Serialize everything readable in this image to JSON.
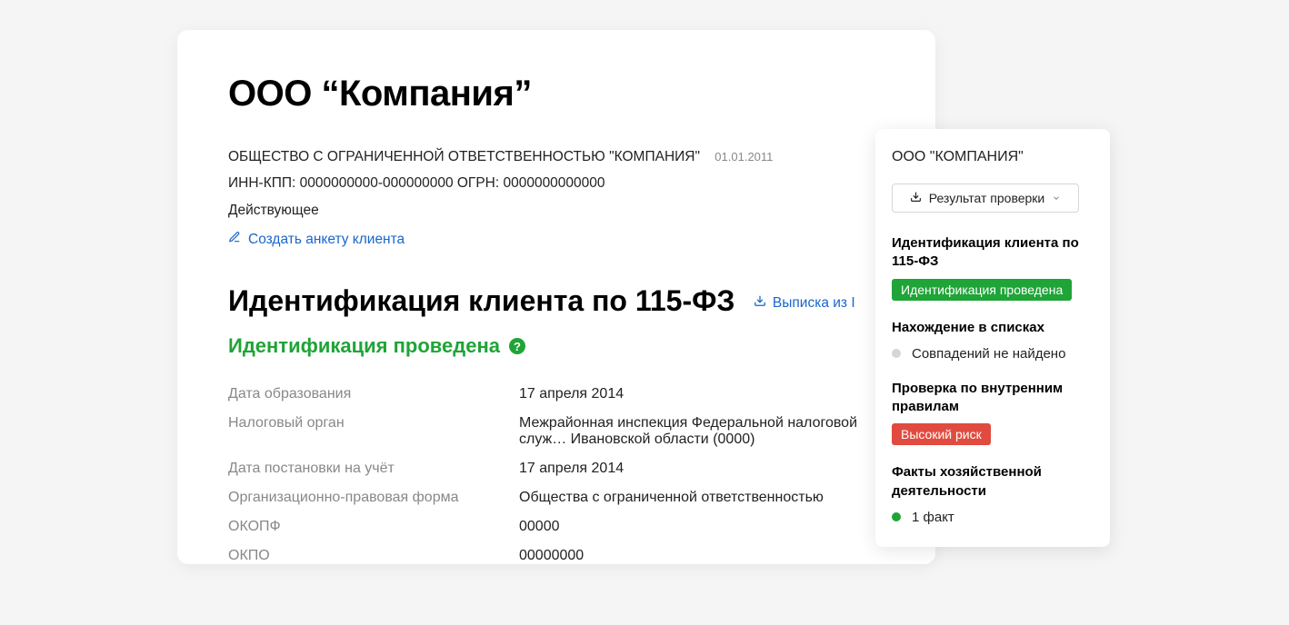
{
  "company": {
    "title": "ООО “Компания”",
    "full_name": "ОБЩЕСТВО С ОГРАНИЧЕННОЙ ОТВЕТСТВЕННОСТЬЮ \"КОМПАНИЯ\"",
    "reg_date_small": "01.01.2011",
    "inn_kpp_ogrn": "ИНН-КПП: 0000000000-000000000 ОГРН: 0000000000000",
    "status": "Действующее",
    "create_link": "Создать анкету клиента"
  },
  "identification": {
    "heading": "Идентификация клиента по 115-ФЗ",
    "download_excerpt": "Выписка из I",
    "status_text": "Идентификация проведена",
    "rows": [
      {
        "key": "Дата образования",
        "val": "17 апреля 2014"
      },
      {
        "key": "Налоговый орган",
        "val": "Межрайонная инспекция Федеральной налоговой служ… Ивановской области (0000)"
      },
      {
        "key": "Дата постановки на учёт",
        "val": "17 апреля 2014"
      },
      {
        "key": "Организационно-правовая форма",
        "val": "Общества с ограниченной ответственностью"
      },
      {
        "key": "ОКОПФ",
        "val": "00000"
      },
      {
        "key": "ОКПО",
        "val": "00000000"
      }
    ]
  },
  "sidebar": {
    "title": "ООО \"КОМПАНИЯ\"",
    "result_button": "Результат проверки",
    "sections": {
      "identification": {
        "title": "Идентификация клиента по 115-ФЗ",
        "badge": "Идентификация проведена"
      },
      "lists": {
        "title": "Нахождение в списках",
        "status": "Совпадений не найдено"
      },
      "internal": {
        "title": "Проверка по внутренним правилам",
        "badge": "Высокий риск"
      },
      "facts": {
        "title": "Факты хозяйственной деятельности",
        "status": "1 факт"
      }
    }
  },
  "colors": {
    "green": "#1fa437",
    "red": "#e14b3f",
    "link": "#1a66cc"
  }
}
